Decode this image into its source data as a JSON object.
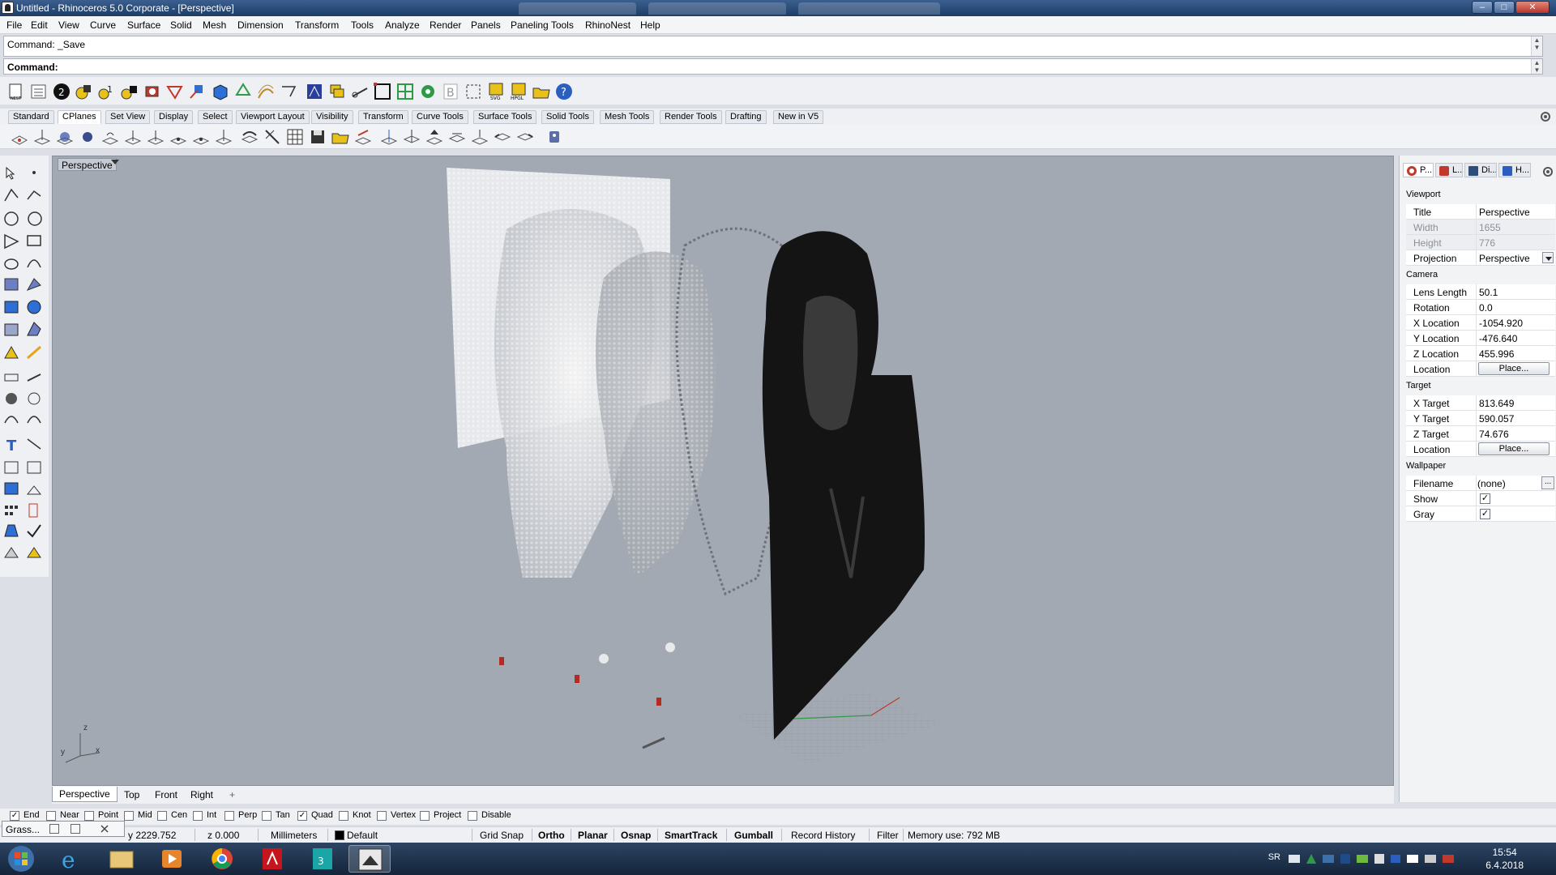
{
  "titlebar": {
    "title": "Untitled - Rhinoceros  5.0 Corporate - [Perspective]",
    "minimize": "–",
    "maximize": "□",
    "close": "✕"
  },
  "menu": [
    "File",
    "Edit",
    "View",
    "Curve",
    "Surface",
    "Solid",
    "Mesh",
    "Dimension",
    "Transform",
    "Tools",
    "Analyze",
    "Render",
    "Panels",
    "Paneling Tools",
    "RhinoNest",
    "Help"
  ],
  "command": {
    "history": "Command: _Save",
    "prompt": "Command:"
  },
  "toolbar_tabs": [
    "Standard",
    "CPlanes",
    "Set View",
    "Display",
    "Select",
    "Viewport Layout",
    "Visibility",
    "Transform",
    "Curve Tools",
    "Surface Tools",
    "Solid Tools",
    "Mesh Tools",
    "Render Tools",
    "Drafting",
    "New in V5"
  ],
  "active_toolbar_tab": "CPlanes",
  "viewport": {
    "label": "Perspective",
    "axis_z": "z",
    "axis_y": "y",
    "axis_x": "x",
    "tabs": [
      "Perspective",
      "Top",
      "Front",
      "Right"
    ],
    "add_tab": "+"
  },
  "panel": {
    "tabs": [
      "P...",
      "L...",
      "Di...",
      "H..."
    ],
    "sections": {
      "viewport": "Viewport",
      "camera": "Camera",
      "target": "Target",
      "wallpaper": "Wallpaper"
    },
    "viewport_rows": {
      "title_k": "Title",
      "title_v": "Perspective",
      "width_k": "Width",
      "width_v": "1655",
      "height_k": "Height",
      "height_v": "776",
      "projection_k": "Projection",
      "projection_v": "Perspective"
    },
    "camera_rows": {
      "lens_k": "Lens Length",
      "lens_v": "50.1",
      "rotation_k": "Rotation",
      "rotation_v": "0.0",
      "xloc_k": "X Location",
      "xloc_v": "-1054.920",
      "yloc_k": "Y Location",
      "yloc_v": "-476.640",
      "zloc_k": "Z Location",
      "zloc_v": "455.996",
      "location_k": "Location",
      "place": "Place..."
    },
    "target_rows": {
      "xt_k": "X Target",
      "xt_v": "813.649",
      "yt_k": "Y Target",
      "yt_v": "590.057",
      "zt_k": "Z Target",
      "zt_v": "74.676",
      "location_k": "Location",
      "place": "Place..."
    },
    "wallpaper_rows": {
      "filename_k": "Filename",
      "filename_v": "(none)",
      "browse": "...",
      "show_k": "Show",
      "gray_k": "Gray",
      "check": "✓"
    }
  },
  "osnaps": [
    {
      "label": "End",
      "checked": true
    },
    {
      "label": "Near",
      "checked": false
    },
    {
      "label": "Point",
      "checked": false
    },
    {
      "label": "Mid",
      "checked": false
    },
    {
      "label": "Cen",
      "checked": false
    },
    {
      "label": "Int",
      "checked": false
    },
    {
      "label": "Perp",
      "checked": false
    },
    {
      "label": "Tan",
      "checked": false
    },
    {
      "label": "Quad",
      "checked": true
    },
    {
      "label": "Knot",
      "checked": false
    },
    {
      "label": "Vertex",
      "checked": false
    },
    {
      "label": "Project",
      "checked": false
    },
    {
      "label": "Disable",
      "checked": false
    }
  ],
  "status": {
    "y": "y 2229.752",
    "z": "z 0.000",
    "units": "Millimeters",
    "layer": "Default",
    "grid_snap": "Grid Snap",
    "ortho": "Ortho",
    "planar": "Planar",
    "osnap": "Osnap",
    "smarttrack": "SmartTrack",
    "gumball": "Gumball",
    "record_history": "Record History",
    "filter": "Filter",
    "memory": "Memory use: 792 MB"
  },
  "grasshopper": {
    "label": "Grass..."
  },
  "taskbar": {
    "lang": "SR",
    "time": "15:54",
    "date": "6.4.2018"
  },
  "colors": {
    "accent": "#3b5f8f",
    "viewport_bg": "#a3a9b2",
    "record_red": "#c0392b"
  }
}
